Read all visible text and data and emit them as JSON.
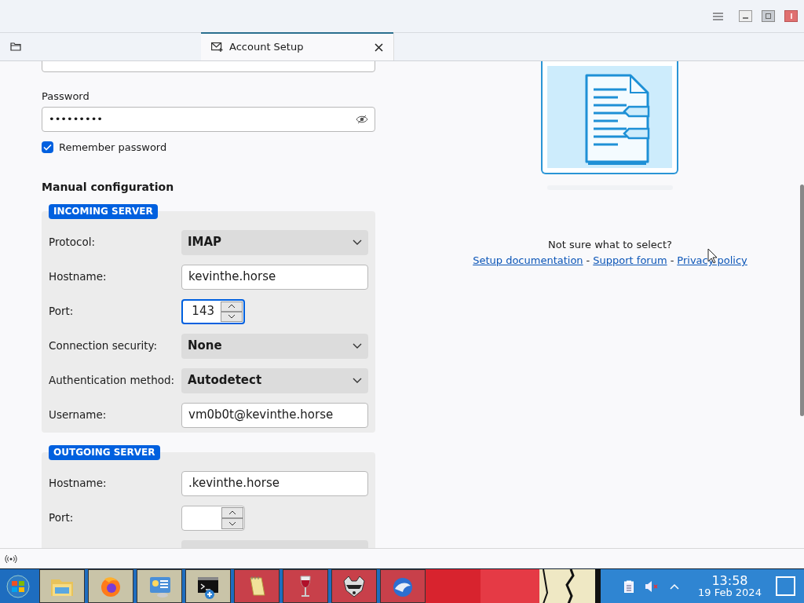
{
  "tabs": [
    {
      "kind": "folder",
      "selected": false
    },
    {
      "kind": "mail",
      "label": "Account Setup",
      "selected": true
    }
  ],
  "password": {
    "label": "Password",
    "value": "•••••••••"
  },
  "remember": {
    "label": "Remember password",
    "checked": true
  },
  "manual_heading": "Manual configuration",
  "incoming": {
    "title": "INCOMING SERVER",
    "fields": [
      {
        "kind": "select",
        "label": "Protocol:",
        "value": "IMAP"
      },
      {
        "kind": "text",
        "label": "Hostname:",
        "value": "kevinthe.horse"
      },
      {
        "kind": "spin",
        "label": "Port:",
        "value": "143",
        "focused": true
      },
      {
        "kind": "select",
        "label": "Connection security:",
        "value": "None"
      },
      {
        "kind": "select",
        "label": "Authentication method:",
        "value": "Autodetect"
      },
      {
        "kind": "text",
        "label": "Username:",
        "value": "vm0b0t@kevinthe.horse"
      }
    ]
  },
  "outgoing": {
    "title": "OUTGOING SERVER",
    "fields": [
      {
        "kind": "text",
        "label": "Hostname:",
        "value": ".kevinthe.horse"
      },
      {
        "kind": "spin",
        "label": "Port:",
        "focused": false
      },
      {
        "kind": "select"
      }
    ]
  },
  "help": {
    "question": "Not sure what to select?",
    "links": [
      "Setup documentation",
      "Support forum",
      "Privacy policy"
    ],
    "separator": "-"
  },
  "taskbar": {
    "apps": [
      {
        "kind": "files"
      },
      {
        "kind": "firefox"
      },
      {
        "kind": "network"
      },
      {
        "kind": "terminal"
      },
      {
        "kind": "notepad"
      },
      {
        "kind": "wine"
      },
      {
        "kind": "raccoon"
      },
      {
        "kind": "thunderbird"
      }
    ],
    "time": "13:58",
    "date": "19 Feb 2024"
  }
}
